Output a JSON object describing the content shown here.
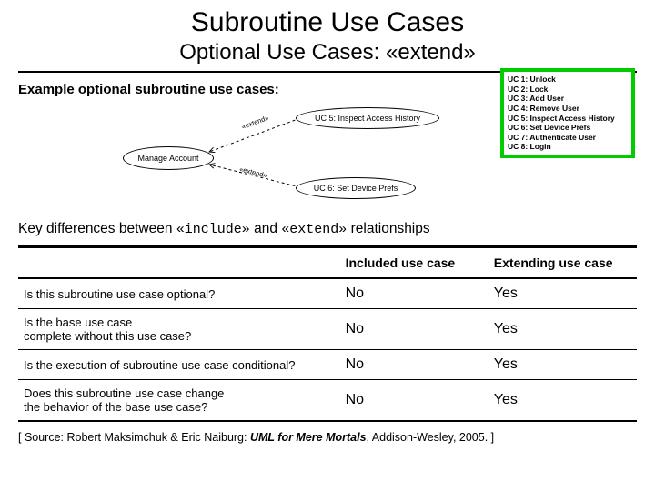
{
  "title": "Subroutine Use Cases",
  "subtitle": "Optional Use Cases: «extend»",
  "example_label": "Example optional subroutine use cases:",
  "uc_list": {
    "uc1": "UC 1: Unlock",
    "uc2": "UC 2: Lock",
    "uc3": "UC 3: Add User",
    "uc4": "UC 4: Remove User",
    "uc5": "UC 5: Inspect Access History",
    "uc6": "UC 6: Set Device Prefs",
    "uc7": "UC 7: Authenticate User",
    "uc8": "UC 8: Login"
  },
  "diagram": {
    "base": "Manage Account",
    "ext1": "UC 5: Inspect Access History",
    "ext2": "UC 6: Set Device Prefs",
    "label1": "«extend»",
    "label2": "«extend»"
  },
  "key_diff_prefix": "Key differences between ",
  "key_diff_include": "«include»",
  "key_diff_and": " and ",
  "key_diff_extend": "«extend»",
  "key_diff_suffix": " relationships",
  "table": {
    "head_q": "",
    "head_included": "Included use case",
    "head_extending": "Extending use case",
    "rows": [
      {
        "q": "Is this subroutine use case optional?",
        "inc": "No",
        "ext": "Yes"
      },
      {
        "q": "Is the base use case\ncomplete without this use case?",
        "inc": "No",
        "ext": "Yes"
      },
      {
        "q": "Is the execution of subroutine use case conditional?",
        "inc": "No",
        "ext": "Yes"
      },
      {
        "q": "Does this subroutine use case change\nthe behavior of the base use case?",
        "inc": "No",
        "ext": "Yes"
      }
    ]
  },
  "source": {
    "prefix": "[ Source: Robert Maksimchuk & Eric Naiburg: ",
    "title": "UML for Mere Mortals",
    "suffix": ", Addison-Wesley, 2005. ]"
  }
}
